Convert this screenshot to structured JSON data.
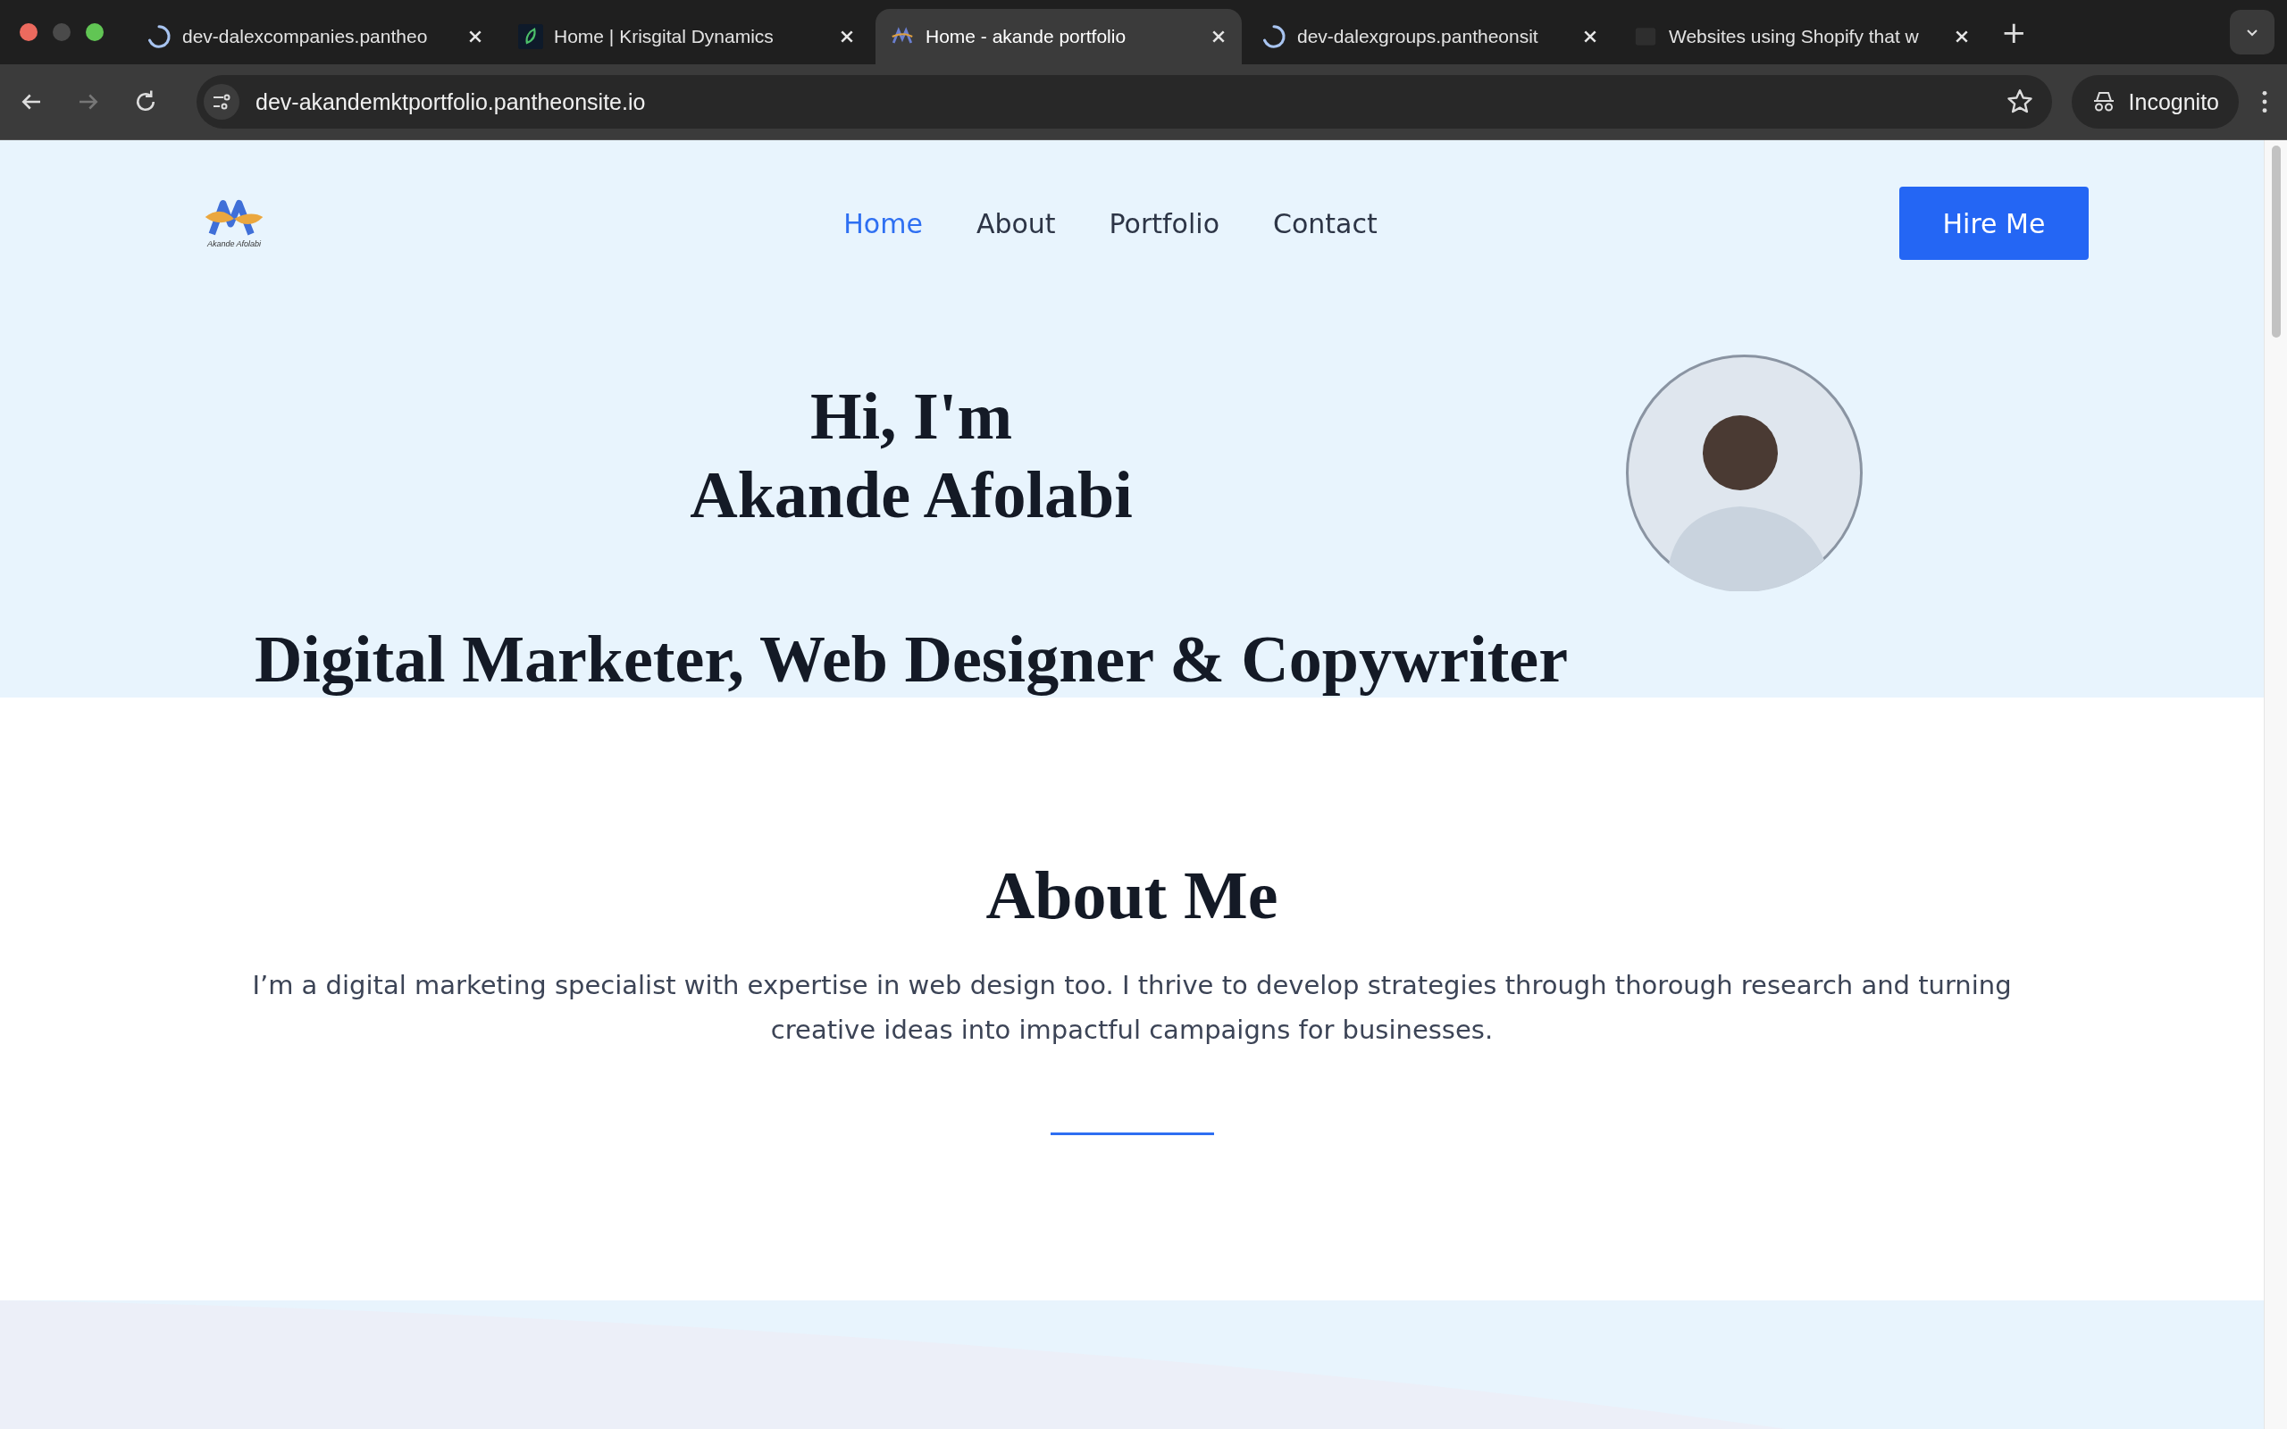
{
  "browser": {
    "tabs": [
      {
        "title": "dev-dalexcompanies.pantheo",
        "kind": "loading",
        "selected": false
      },
      {
        "title": "Home | Krisgital Dynamics",
        "kind": "leaf",
        "selected": false
      },
      {
        "title": "Home - akande portfolio",
        "kind": "logo",
        "selected": true
      },
      {
        "title": "dev-dalexgroups.pantheonsit",
        "kind": "loading",
        "selected": false
      },
      {
        "title": "Websites using Shopify that w",
        "kind": "faded",
        "selected": false
      }
    ],
    "new_tab": "+",
    "url": "dev-akandemktportfolio.pantheonsite.io",
    "profile": "Incognito"
  },
  "nav": {
    "logo_text": "Akande Afolabi",
    "links": [
      {
        "label": "Home",
        "selected": true
      },
      {
        "label": "About",
        "selected": false
      },
      {
        "label": "Portfolio",
        "selected": false
      },
      {
        "label": "Contact",
        "selected": false
      }
    ],
    "cta": "Hire Me"
  },
  "hero": {
    "greeting": "Hi, I'm",
    "name": "Akande Afolabi",
    "tagline": "Digital Marketer, Web Designer & Copywriter"
  },
  "about": {
    "heading": "About Me",
    "text": "I’m a digital marketing specialist with expertise in web design too. I thrive to develop strategies through thorough research and turning creative ideas into impactful campaigns for businesses."
  }
}
